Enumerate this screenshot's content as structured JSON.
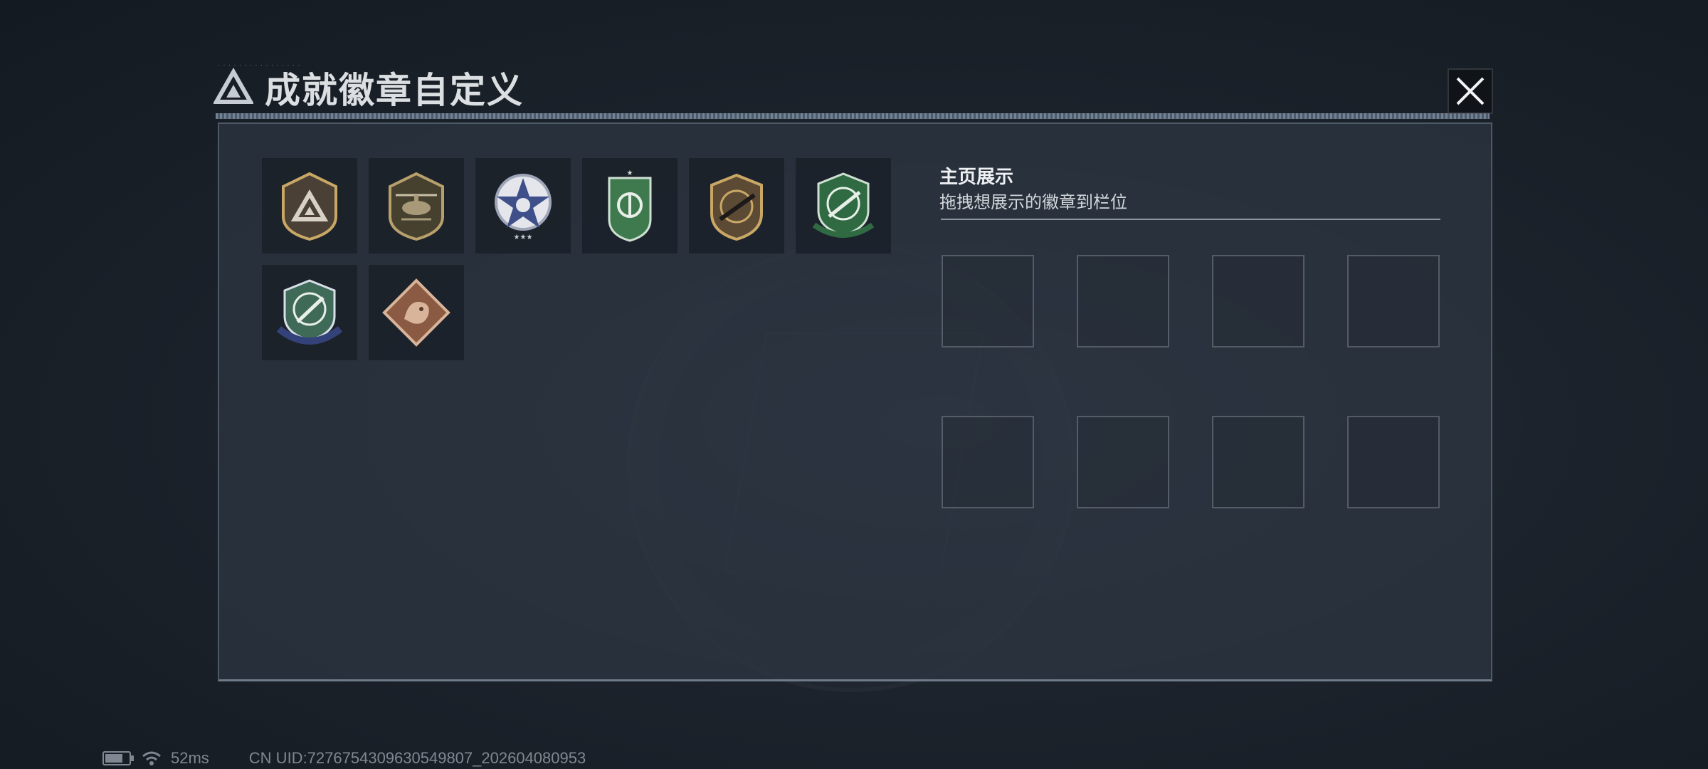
{
  "header": {
    "title": "成就徽章自定义",
    "logo_icon": "triangle-emblem-icon",
    "close_icon": "close-icon"
  },
  "badges": [
    {
      "name": "gold-triangle-shield-badge",
      "icon": "triangle-shield-icon"
    },
    {
      "name": "helicopter-shield-badge",
      "icon": "helicopter-icon"
    },
    {
      "name": "blue-star-badge",
      "icon": "star-badge-icon"
    },
    {
      "name": "green-ribbon-badge",
      "icon": "green-shield-icon"
    },
    {
      "name": "rifle-shield-badge",
      "icon": "rifle-icon"
    },
    {
      "name": "green-crosshair-rifle-badge",
      "icon": "crosshair-rifle-icon"
    },
    {
      "name": "blue-crosshair-knife-badge",
      "icon": "crosshair-knife-icon"
    },
    {
      "name": "dragon-diamond-badge",
      "icon": "dragon-icon"
    }
  ],
  "showcase": {
    "title": "主页展示",
    "hint": "拖拽想展示的徽章到栏位",
    "slot_count": 8
  },
  "statusbar": {
    "battery_icon": "battery-icon",
    "wifi_icon": "wifi-icon",
    "ping": "52ms",
    "uid": "CN UID:7276754309630549807_202604080953"
  },
  "colors": {
    "panel_bg": "#2c3440",
    "accent_gold": "#c9a866",
    "accent_green": "#3f7a4e",
    "accent_blue": "#3f4f8a"
  }
}
